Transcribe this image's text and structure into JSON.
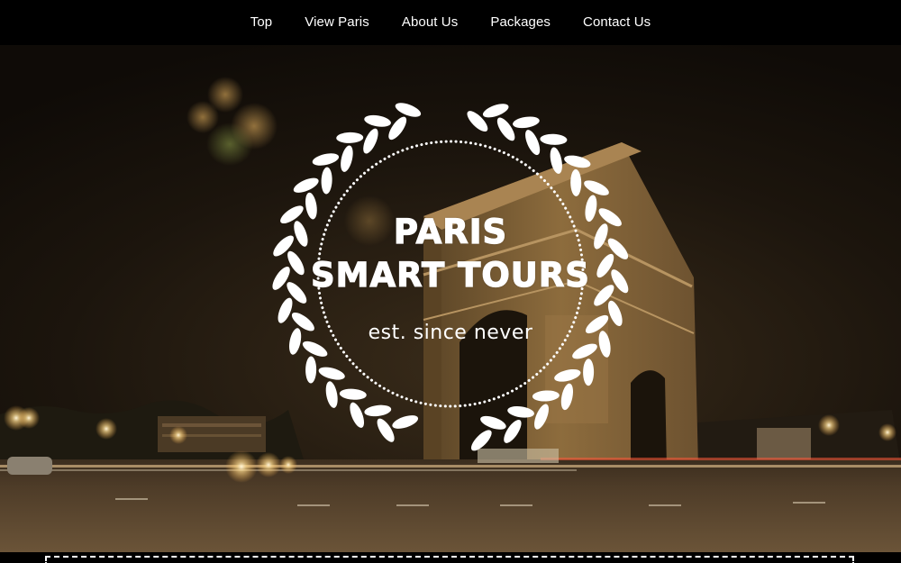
{
  "nav": {
    "items": [
      {
        "label": "Top"
      },
      {
        "label": "View Paris"
      },
      {
        "label": "About Us"
      },
      {
        "label": "Packages"
      },
      {
        "label": "Contact Us"
      }
    ]
  },
  "hero": {
    "brand_line_1": "PARIS",
    "brand_line_2": "SMART TOURS",
    "tagline": "est. since never",
    "background": "night photo of the Arc de Triomphe with traffic light trails",
    "emblem": "laurel-wreath-icon"
  },
  "colors": {
    "nav_background": "#000000",
    "nav_text": "#ffffff",
    "emblem": "#ffffff",
    "sky": "#1a140d",
    "monument": "#8a6a3c",
    "ground": "#5a4733"
  }
}
